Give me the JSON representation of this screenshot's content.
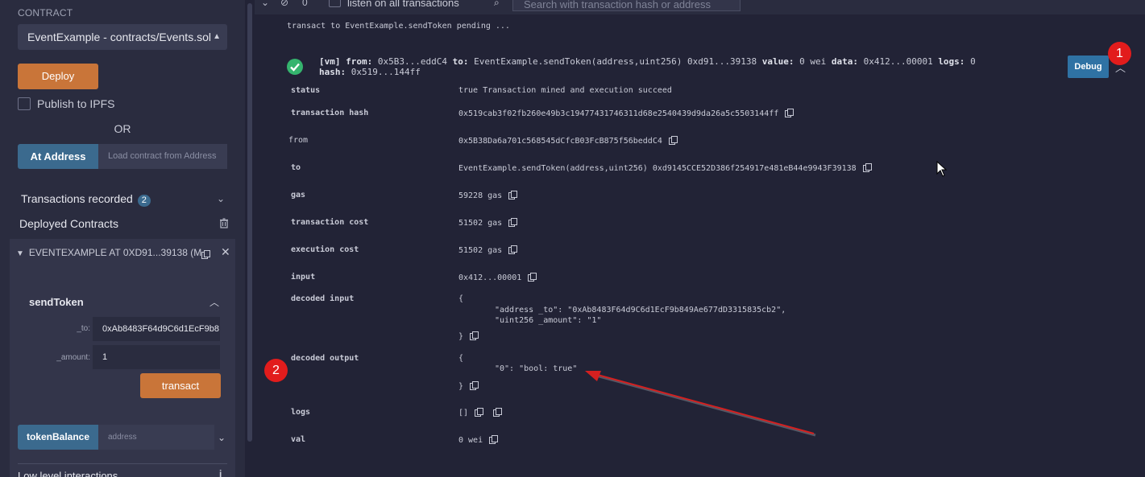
{
  "sidebar": {
    "contract_label": "CONTRACT",
    "contract_select": "EventExample - contracts/Events.sol",
    "deploy_label": "Deploy",
    "publish_label": "Publish to IPFS",
    "or_label": "OR",
    "at_address_label": "At Address",
    "at_address_placeholder": "Load contract from Address",
    "transactions_recorded_label": "Transactions recorded",
    "transactions_recorded_count": "2",
    "deployed_contracts_label": "Deployed Contracts",
    "instance": {
      "title": "EVENTEXAMPLE AT 0XD91...39138 (M",
      "function_name": "sendToken",
      "params": [
        {
          "label": "_to:",
          "value": "0xAb8483F64d9C6d1EcF9b8"
        },
        {
          "label": "_amount:",
          "value": "1"
        }
      ],
      "transact_label": "transact",
      "token_balance_label": "tokenBalance",
      "token_balance_placeholder": "address",
      "low_level_label": "Low level interactions",
      "info_icon": "i"
    }
  },
  "terminal": {
    "pending_count": "0",
    "listen_label": "listen on all transactions",
    "search_placeholder": "Search with transaction hash or address",
    "pending_line": "transact to EventExample.sendToken pending ...",
    "summary": {
      "tag": "[vm]",
      "from_key": "from:",
      "from_val": "0x5B3...eddC4",
      "to_key": "to:",
      "to_val": "EventExample.sendToken(address,uint256) 0xd91...39138",
      "value_key": "value:",
      "value_val": "0 wei",
      "data_key": "data:",
      "data_val": "0x412...00001",
      "logs_key": "logs:",
      "logs_val": "0",
      "hash_key": "hash:",
      "hash_val": "0x519...144ff"
    },
    "debug_label": "Debug",
    "rows": {
      "status": {
        "key": "status",
        "value": "true Transaction mined and execution succeed"
      },
      "transaction_hash": {
        "key": "transaction hash",
        "value": "0x519cab3f02fb260e49b3c19477431746311d68e2540439d9da26a5c5503144ff"
      },
      "from": {
        "key": "from",
        "value": "0x5B38Da6a701c568545dCfcB03FcB875f56beddC4"
      },
      "to": {
        "key": "to",
        "value": "EventExample.sendToken(address,uint256) 0xd9145CCE52D386f254917e481eB44e9943F39138"
      },
      "gas": {
        "key": "gas",
        "value": "59228 gas"
      },
      "transaction_cost": {
        "key": "transaction cost",
        "value": "51502 gas"
      },
      "execution_cost": {
        "key": "execution cost",
        "value": "51502 gas"
      },
      "input": {
        "key": "input",
        "value": "0x412...00001"
      },
      "decoded_input": {
        "key": "decoded input",
        "open": "{",
        "line1": "\"address _to\": \"0xAb8483F64d9C6d1EcF9b849Ae677dD3315835cb2\",",
        "line2": "\"uint256 _amount\": \"1\"",
        "close": "}"
      },
      "decoded_output": {
        "key": "decoded output",
        "open": "{",
        "line1": "\"0\": \"bool: true\"",
        "close": "}"
      },
      "logs": {
        "key": "logs",
        "value": "[]"
      },
      "val": {
        "key": "val",
        "value": "0 wei"
      }
    }
  },
  "annotations": {
    "marker1": "1",
    "marker2": "2",
    "arrow_color": "#d42020"
  }
}
